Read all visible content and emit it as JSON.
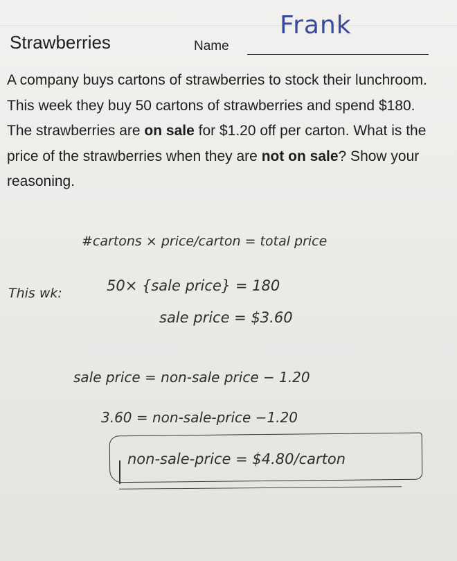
{
  "header": {
    "title": "Strawberries",
    "name_label": "Name",
    "student_name": "Frank"
  },
  "problem": {
    "line_1": "A company buys cartons of strawberries to stock their lunchroom. This week they buy 50 cartons of strawberries and spend $180. The strawberries are ",
    "bold_1": "on sale",
    "line_2": " for $1.20 off per carton. What is the price of the strawberries when they are ",
    "bold_2": "not on sale",
    "line_3": "? Show your reasoning."
  },
  "work": {
    "formula": "#cartons × price/carton = total price",
    "this_week_label": "This wk:",
    "equation_1": "50× {sale price} = 180",
    "sale_price_result": "sale price = $3.60",
    "equation_2": "sale price = non-sale price − 1.20",
    "equation_3": "3.60 = non-sale-price −1.20",
    "final_answer": "non-sale-price = $4.80/carton"
  }
}
